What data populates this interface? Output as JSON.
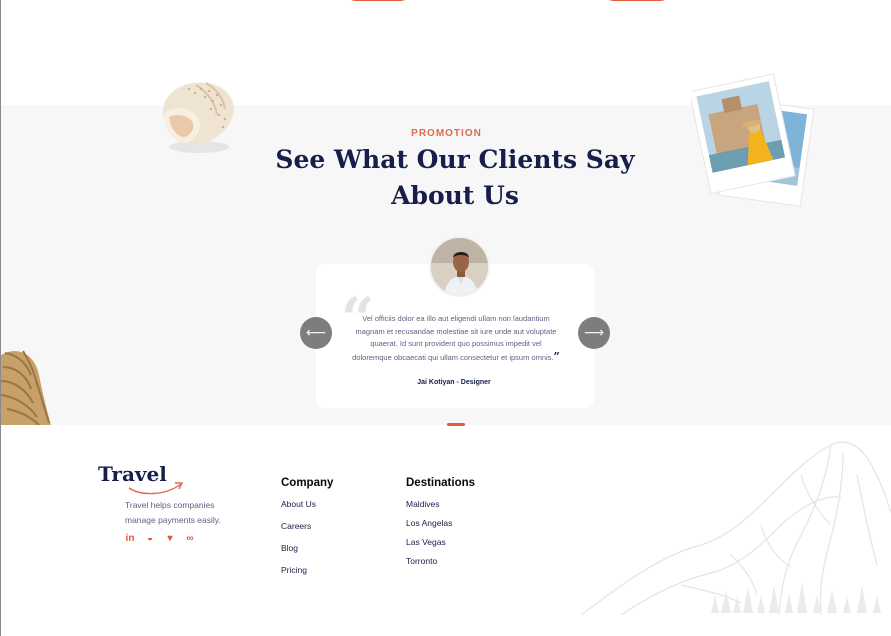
{
  "testimonial": {
    "eyebrow": "PROMOTION",
    "title_line1": "See What Our Clients Say",
    "title_line2": "About Us",
    "quote": "Vel officiis dolor ea illo aut eligendi ullam non laudantium magnam et recusandae molestiae sit iure unde aut voluptate quaerat. Id sunt provident quo possimus impedit vel doloremque obcaecati qui ullam consectetur et ipsum omnis.",
    "author": "Jai Kotiyan - Designer",
    "prev_icon": "arrow-left-icon",
    "next_icon": "arrow-right-icon",
    "prev_glyph": "⟵",
    "next_glyph": "⟶"
  },
  "footer": {
    "brand": "Travel",
    "tagline": "Travel helps companies manage payments easily.",
    "socials": [
      {
        "icon": "linkedin-icon",
        "glyph": "in"
      },
      {
        "icon": "messenger-icon",
        "glyph": "◒"
      },
      {
        "icon": "twitter-icon",
        "glyph": "▾"
      },
      {
        "icon": "link-icon",
        "glyph": "∞"
      }
    ],
    "company": {
      "heading": "Company",
      "links": [
        "About Us",
        "Careers",
        "Blog",
        "Pricing"
      ]
    },
    "destinations": {
      "heading": "Destinations",
      "links": [
        "Maldives",
        "Los Angelas",
        "Las Vegas",
        "Torronto"
      ]
    }
  },
  "colors": {
    "accent": "#e15b39",
    "heading": "#181e4b",
    "muted": "#5e6282",
    "band": "#f7f7f7"
  }
}
